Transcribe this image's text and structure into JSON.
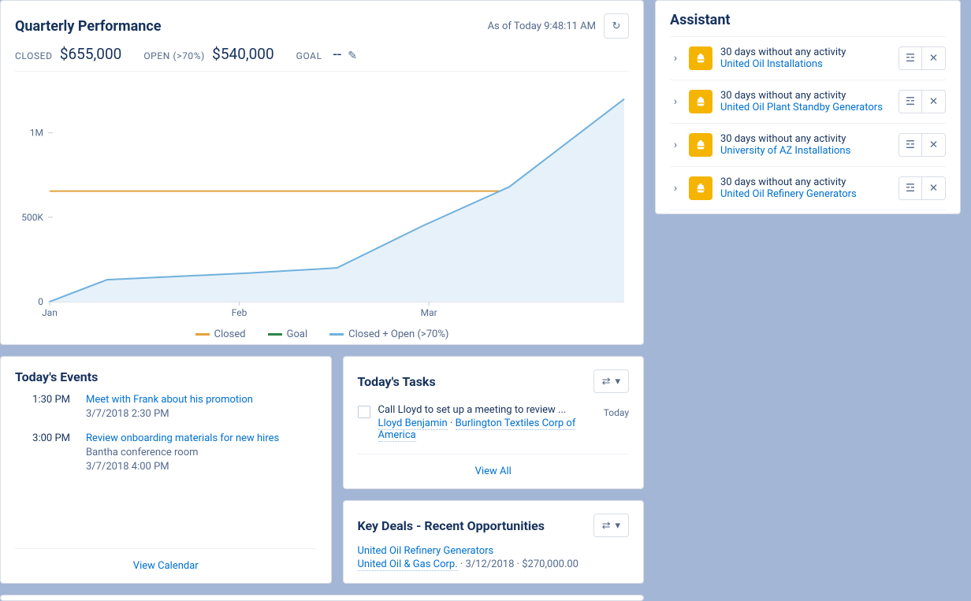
{
  "quarterly_performance": {
    "title": "Quarterly Performance",
    "as_of": "As of Today 9:48:11 AM",
    "metrics": {
      "closed_label": "CLOSED",
      "closed_value": "$655,000",
      "open_label": "OPEN (>70%)",
      "open_value": "$540,000",
      "goal_label": "GOAL",
      "goal_value": "--"
    },
    "legend": {
      "closed": "Closed",
      "goal": "Goal",
      "closed_open": "Closed + Open (>70%)"
    }
  },
  "chart_data": {
    "type": "line",
    "x_categories": [
      "Jan",
      "Feb",
      "Mar"
    ],
    "y_ticks": [
      "0",
      "500K",
      "1M"
    ],
    "ylim": [
      0,
      1250000
    ],
    "series": [
      {
        "name": "Closed",
        "style": "flat",
        "color": "#e6a23c",
        "value": 655000
      },
      {
        "name": "Goal",
        "style": "flat",
        "color": "#2e844a",
        "value": null
      },
      {
        "name": "Closed + Open (>70%)",
        "style": "line",
        "color": "#6fb1dd",
        "points": [
          {
            "x": 0.0,
            "y": 0
          },
          {
            "x": 0.1,
            "y": 130000
          },
          {
            "x": 0.35,
            "y": 170000
          },
          {
            "x": 0.5,
            "y": 200000
          },
          {
            "x": 0.65,
            "y": 450000
          },
          {
            "x": 0.8,
            "y": 680000
          },
          {
            "x": 1.0,
            "y": 1200000
          }
        ]
      }
    ]
  },
  "events": {
    "title": "Today's Events",
    "items": [
      {
        "time": "1:30 PM",
        "title": "Meet with Frank about his promotion",
        "sub1": "3/7/2018 2:30 PM",
        "sub2": ""
      },
      {
        "time": "3:00 PM",
        "title": "Review onboarding materials for new hires",
        "sub1": "Bantha conference room",
        "sub2": "3/7/2018 4:00 PM"
      }
    ],
    "footer": "View Calendar"
  },
  "tasks": {
    "title": "Today's Tasks",
    "items": [
      {
        "title": "Call Lloyd to set up a meeting to review ...",
        "contact": "Lloyd Benjamin",
        "account": "Burlington Textiles Corp of America",
        "due": "Today"
      }
    ],
    "footer": "View All"
  },
  "deals": {
    "title": "Key Deals - Recent Opportunities",
    "items": [
      {
        "name": "United Oil Refinery Generators",
        "account": "United Oil & Gas Corp.",
        "date": "3/12/2018",
        "amount": "$270,000.00"
      }
    ]
  },
  "assistant": {
    "title": "Assistant",
    "items": [
      {
        "message": "30 days without any activity",
        "link": "United Oil Installations"
      },
      {
        "message": "30 days without any activity",
        "link": "United Oil Plant Standby Generators"
      },
      {
        "message": "30 days without any activity",
        "link": "University of AZ Installations"
      },
      {
        "message": "30 days without any activity",
        "link": "United Oil Refinery Generators"
      }
    ]
  }
}
